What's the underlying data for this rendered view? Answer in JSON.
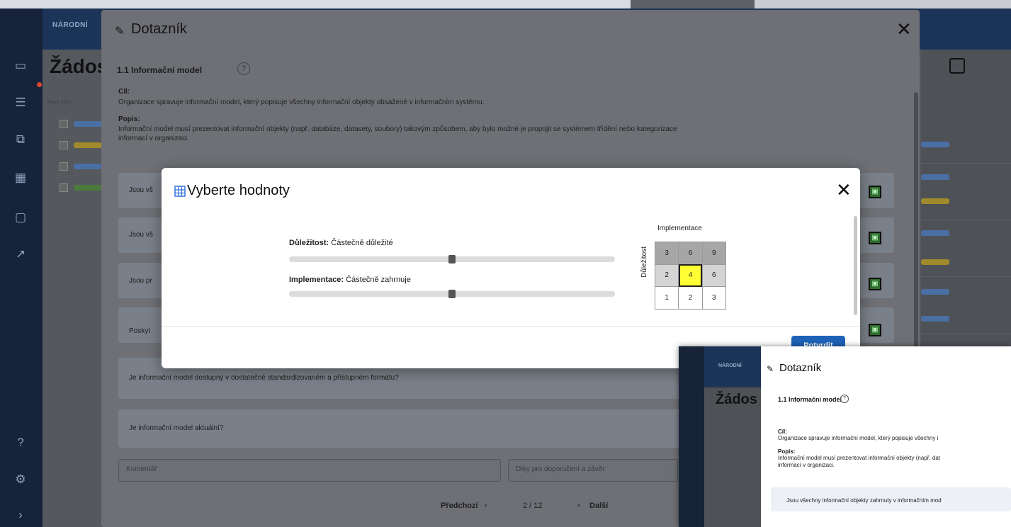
{
  "background_app": {
    "brand": "NÁRODNÍ",
    "page_title": "Žádos",
    "filter_label": "Stavy žádo"
  },
  "dialog": {
    "title": "Dotazník",
    "section_title": "1.1 Informační model",
    "help_icon": "?",
    "goal_label": "Cíl:",
    "goal_text": "Organizace spravuje informační model, který popisuje všechny informační objekty obsažené v informačním systému.",
    "desc_label": "Popis:",
    "desc_text_line1": "Informační model musí prezentovat informační objekty (např. databáze, datasety, soubory) takovým způsobem, aby bylo možné je propojit se systémem třídění nebo kategorizace",
    "desc_text_line2": "informací v organizaci.",
    "questions": [
      {
        "text": "Jsou vš"
      },
      {
        "text": "Jsou vš"
      },
      {
        "text": "Jsou pr"
      },
      {
        "text": "Poskyt"
      },
      {
        "text": "Je informační model dostupný v dostatečně standardizovaném a přístupném formátu?"
      },
      {
        "text": "Je informační model aktuální?"
      }
    ],
    "comment_placeholder": "Komentář",
    "recommendation_placeholder": "Díky pro doporučení a závěr",
    "pager": {
      "prev": "Předchozí",
      "position": "2 / 12",
      "next": "Další"
    }
  },
  "modal": {
    "title": "Vyberte hodnoty",
    "importance_label": "Důležitost:",
    "importance_value": "Částečně důležité",
    "importance_level": 0.5,
    "implementation_label": "Implementace:",
    "implementation_value": "Částečně zahrnuje",
    "implementation_level": 0.5,
    "matrix_col_header": "Implementace",
    "matrix_row_header": "Důležitost",
    "matrix": [
      [
        "3",
        "6",
        "9"
      ],
      [
        "2",
        "4",
        "6"
      ],
      [
        "1",
        "2",
        "3"
      ]
    ],
    "selected_cell": "4",
    "confirm_label": "Potvrdit"
  },
  "inset": {
    "brand": "NÁRODNÍ",
    "page_title": "Žádos",
    "dialog_title": "Dotazník",
    "section_title": "1.1 Informační model",
    "goal_label": "Cíl:",
    "goal_text": "Organizace spravuje informační model, který popisuje všechny i",
    "desc_label": "Popis:",
    "desc_text_line1": "Informační model musí prezentovat informační objekty (např. dat",
    "desc_text_line2": "informací v organizaci.",
    "question": "Jsou všechny informační objekty zahrnuty v informačním mod"
  },
  "colors": {
    "accent": "#1e63b8",
    "sidebar": "#17233a",
    "header": "#1c3457",
    "selected_cell": "#ffff33",
    "status_green": "#2e6b2e"
  }
}
